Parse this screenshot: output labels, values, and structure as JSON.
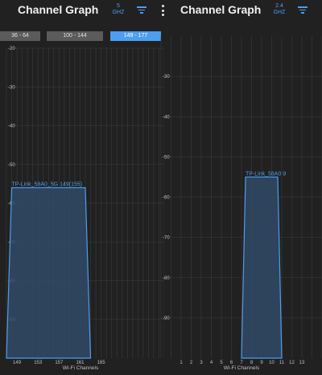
{
  "colors": {
    "accent": "#4d9ef0",
    "background": "#212121",
    "grid": "#3c3c3c",
    "tab_inactive": "#5b5b5b",
    "signal_fill": "#2f4a66"
  },
  "left_panel": {
    "title": "Channel Graph",
    "band_value": "5",
    "band_unit": "GHZ",
    "filter_icon": "filter-icon",
    "tabs": [
      {
        "label": "36 - 64",
        "active": false
      },
      {
        "label": "100 - 144",
        "active": false
      },
      {
        "label": "149 - 177",
        "active": true
      }
    ]
  },
  "right_panel": {
    "menu_icon": "more-vert-icon",
    "title": "Channel Graph",
    "band_value": "2.4",
    "band_unit": "GHZ",
    "filter_icon": "filter-icon"
  },
  "chart_data": [
    {
      "type": "area",
      "xlabel": "Wi-Fi Channels",
      "ylabel": "",
      "x_ticks": [
        149,
        153,
        157,
        161,
        165
      ],
      "xlim": [
        147,
        177
      ],
      "y_ticks": [
        -20,
        -30,
        -40,
        -50,
        -60,
        -70,
        -80,
        -90
      ],
      "ylim": [
        -100,
        -20
      ],
      "grid": true,
      "series": [
        {
          "name": "TP-Link_58A0_5G 149(155)",
          "channel": 149,
          "center_channel": 155,
          "signal_dbm": -56,
          "x": [
            147,
            148,
            162,
            163
          ],
          "y": [
            -100,
            -56,
            -56,
            -100
          ]
        }
      ]
    },
    {
      "type": "area",
      "xlabel": "Wi-Fi Channels",
      "ylabel": "",
      "x_ticks": [
        1,
        2,
        3,
        4,
        5,
        6,
        7,
        8,
        9,
        10,
        11,
        12,
        13
      ],
      "xlim": [
        -1,
        15
      ],
      "y_ticks": [
        -30,
        -40,
        -50,
        -60,
        -70,
        -80,
        -90
      ],
      "ylim": [
        -100,
        -20
      ],
      "grid": true,
      "series": [
        {
          "name": "TP-Link_58A0 9",
          "channel": 9,
          "signal_dbm": -55,
          "x": [
            7,
            7.4,
            10.6,
            11
          ],
          "y": [
            -100,
            -55,
            -55,
            -100
          ]
        }
      ]
    }
  ]
}
